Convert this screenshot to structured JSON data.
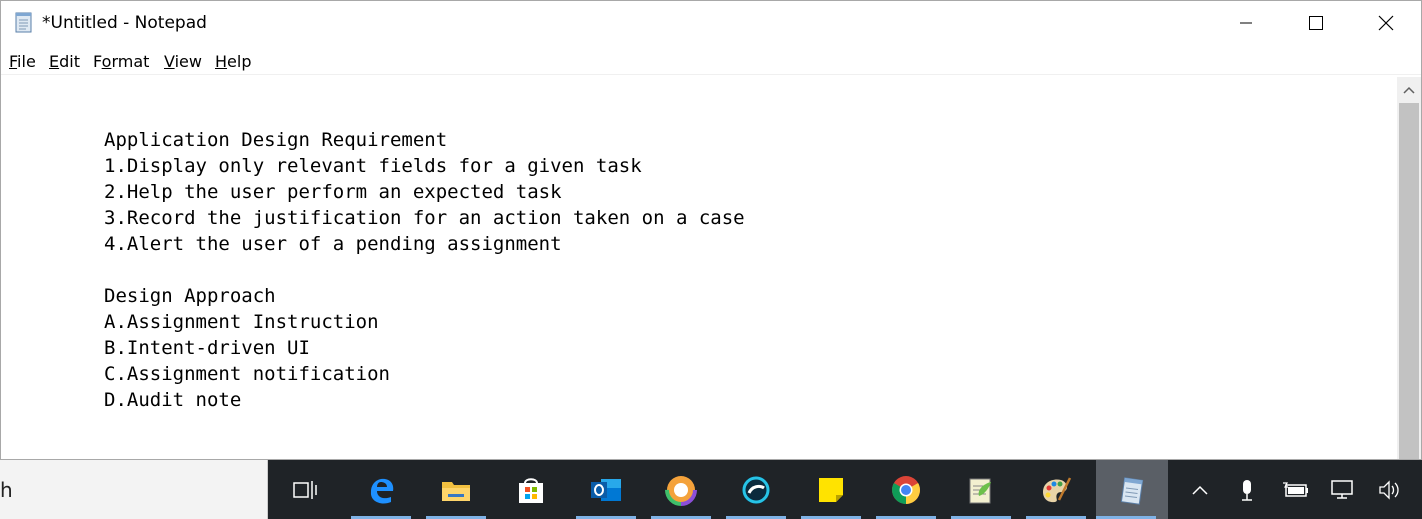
{
  "window": {
    "title": "*Untitled - Notepad",
    "icon": "notepad-icon",
    "controls": [
      "minimize-icon",
      "maximize-icon",
      "close-icon"
    ]
  },
  "menu": {
    "file": {
      "accel": "F",
      "rest": "ile"
    },
    "edit": {
      "accel": "E",
      "rest": "dit"
    },
    "format": {
      "pre": "F",
      "accel": "o",
      "rest": "rmat"
    },
    "view": {
      "accel": "V",
      "rest": "iew"
    },
    "help": {
      "accel": "H",
      "rest": "elp"
    }
  },
  "document": {
    "lines": [
      "Application Design Requirement",
      "1.Display only relevant fields for a given task",
      "2.Help the user perform an expected task",
      "3.Record the justification for an action taken on a case",
      "4.Alert the user of a pending assignment",
      "",
      "Design Approach",
      "A.Assignment Instruction",
      "B.Intent-driven UI",
      "C.Assignment notification",
      "D.Audit note"
    ]
  },
  "taskbar": {
    "search_text": "h",
    "apps": [
      "task-view-icon",
      "edge-icon",
      "file-explorer-icon",
      "store-icon",
      "outlook-icon",
      "camera-app-icon",
      "webex-icon",
      "sticky-notes-icon",
      "chrome-icon",
      "notepadpp-icon",
      "paint-icon",
      "notepad-icon"
    ],
    "tray": [
      "show-hidden-icons-chevron",
      "microphone-icon",
      "battery-icon",
      "network-icon",
      "volume-icon"
    ]
  },
  "colors": {
    "taskbar_bg": "#1f2327",
    "running_indicator": "#7fb2e6",
    "scrollbar_track": "#f0f0f0",
    "scrollbar_thumb": "#c2c2c2"
  }
}
